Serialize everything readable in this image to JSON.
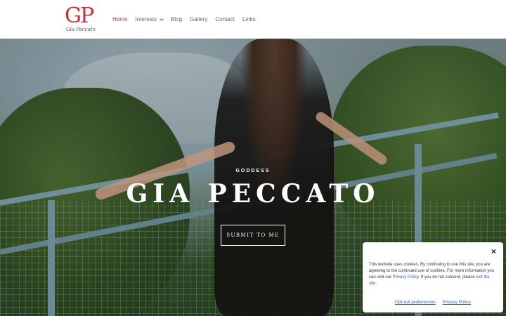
{
  "header": {
    "logo_text": "GP",
    "logo_signature": "Gia Peccato",
    "nav": [
      {
        "label": "Home",
        "active": true
      },
      {
        "label": "Interests",
        "dropdown": true
      },
      {
        "label": "Blog"
      },
      {
        "label": "Gallery"
      },
      {
        "label": "Contact"
      },
      {
        "label": "Links"
      }
    ]
  },
  "hero": {
    "subtitle": "GODDESS",
    "title": "GIA PECCATO",
    "button_label": "SUBMIT TO ME"
  },
  "cookie": {
    "message_prefix": "This website uses cookies. By continuing to use this site, you are agreeing to the continued use of cookies. For more information you can visit our ",
    "privacy_link": "Privacy Policy",
    "message_middle": ". If you do not consent, please ",
    "exit_link": "exit the site",
    "message_suffix": ".",
    "opt_out_label": "Opt-out preferences",
    "privacy_policy_label": "Privacy Policy",
    "close_icon": "×"
  },
  "colors": {
    "accent": "#c8303c",
    "link": "#2b5cc7"
  }
}
